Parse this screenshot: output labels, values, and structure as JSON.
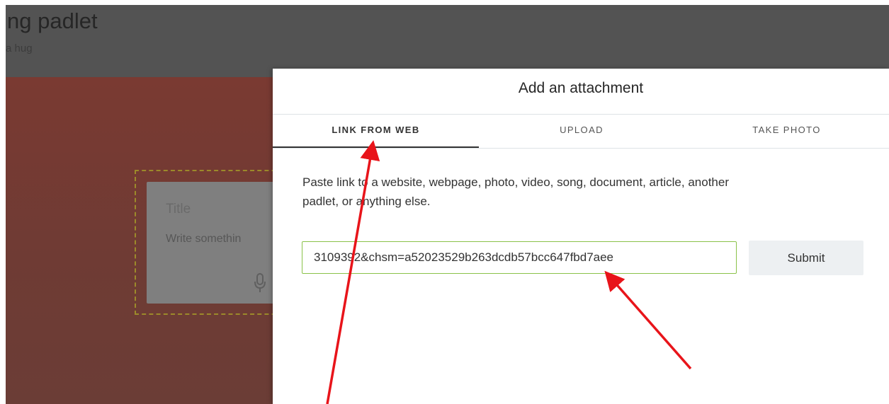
{
  "background": {
    "title": "ng padlet",
    "subtitle": "a hug",
    "post": {
      "title_placeholder": "Title",
      "body_placeholder": "Write somethin"
    }
  },
  "modal": {
    "title": "Add an attachment",
    "tabs": [
      {
        "label": "LINK FROM WEB",
        "active": true
      },
      {
        "label": "UPLOAD",
        "active": false
      },
      {
        "label": "TAKE PHOTO",
        "active": false
      }
    ],
    "instructions_line1": "Paste link to a website, webpage, photo, video, song, document, article, another",
    "instructions_line2": "padlet, or anything else.",
    "link_input_value": "3109392&chsm=a52023529b263dcdb57bcc647fbd7aee",
    "submit_label": "Submit"
  },
  "colors": {
    "header_bg": "#535353",
    "wall_bg": "#7a3a32",
    "input_border": "#8ac249",
    "annotation_red": "#e8141a"
  },
  "icons": [
    "microphone-icon"
  ]
}
